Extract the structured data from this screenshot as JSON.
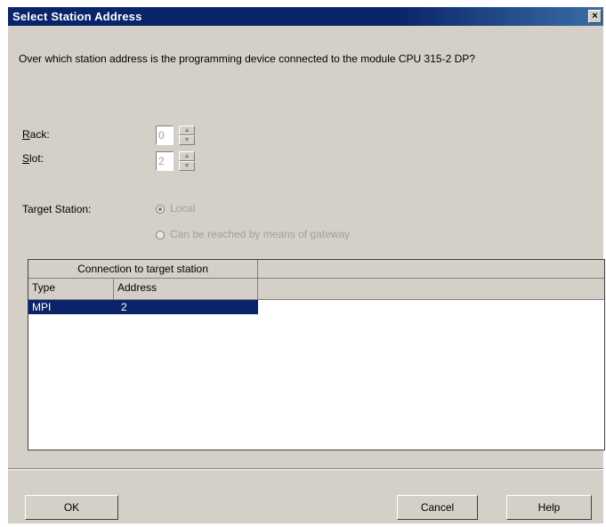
{
  "window": {
    "title": "Select Station Address",
    "close_glyph": "×"
  },
  "question": "Over which station address is the programming device connected to the module CPU 315-2 DP?",
  "rack": {
    "label_first": "R",
    "label_rest": "ack:",
    "value": "0"
  },
  "slot": {
    "label_first": "S",
    "label_rest": "lot:",
    "value": "2"
  },
  "target_station": {
    "label": "Target Station:",
    "options": [
      {
        "label": "Local",
        "checked": true
      },
      {
        "label": "Can be reached by means of gateway",
        "checked": false
      }
    ]
  },
  "connection_table": {
    "group_header": "Connection to target station",
    "columns": [
      "Type",
      "Address"
    ],
    "rows": [
      {
        "type": "MPI",
        "address": "2",
        "selected": true
      }
    ]
  },
  "buttons": {
    "ok": "OK",
    "cancel": "Cancel",
    "help": "Help"
  },
  "colors": {
    "titlebar": "#0a246a",
    "face": "#d4d0c8",
    "selection": "#0a246a"
  }
}
